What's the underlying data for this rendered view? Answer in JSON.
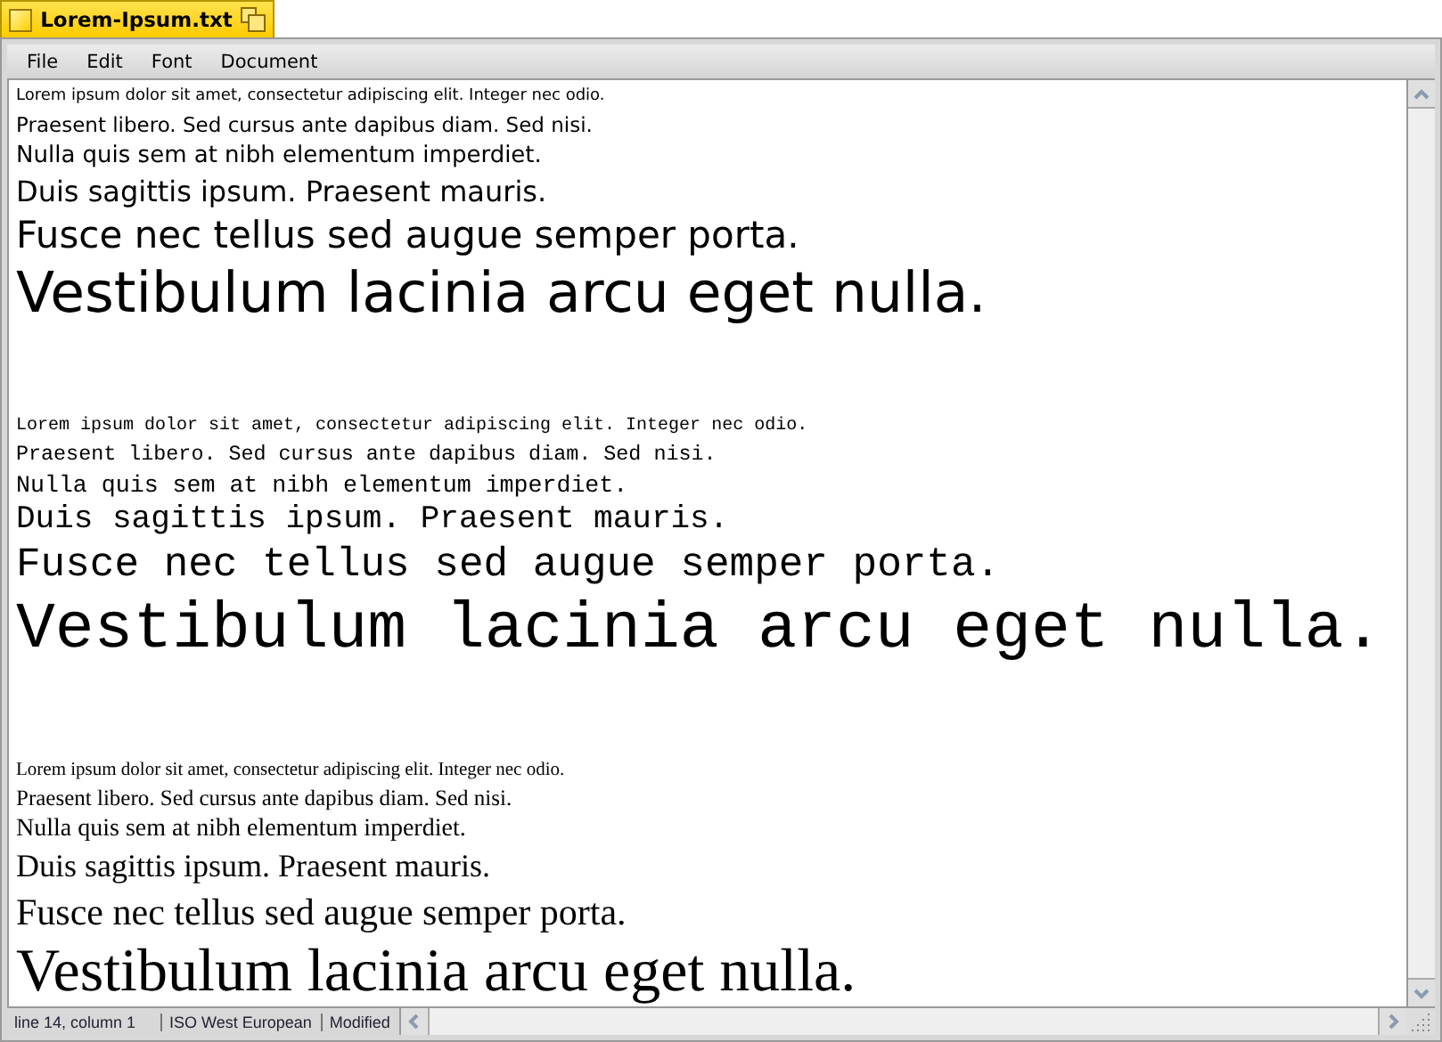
{
  "window": {
    "title": "Lorem-Ipsum.txt"
  },
  "menu": [
    "File",
    "Edit",
    "Font",
    "Document"
  ],
  "blocks": [
    {
      "kind": "sans",
      "lines": [
        "Lorem ipsum dolor sit amet, consectetur adipiscing elit. Integer nec odio.",
        "Praesent libero. Sed cursus ante dapibus diam. Sed nisi.",
        "Nulla quis sem at nibh elementum imperdiet.",
        "Duis sagittis ipsum. Praesent mauris.",
        "Fusce nec tellus sed augue semper porta.",
        "Vestibulum lacinia arcu eget nulla."
      ]
    },
    {
      "kind": "mono",
      "lines": [
        "Lorem ipsum dolor sit amet, consectetur adipiscing elit. Integer nec odio.",
        "Praesent libero. Sed cursus ante dapibus diam. Sed nisi.",
        "Nulla quis sem at nibh elementum imperdiet.",
        "Duis sagittis ipsum. Praesent mauris.",
        "Fusce nec tellus sed augue semper porta.",
        "Vestibulum lacinia arcu eget nulla."
      ]
    },
    {
      "kind": "serif",
      "lines": [
        "Lorem ipsum dolor sit amet, consectetur adipiscing elit. Integer nec odio.",
        "Praesent libero. Sed cursus ante dapibus diam. Sed nisi.",
        "Nulla quis sem at nibh elementum imperdiet.",
        "Duis sagittis ipsum. Praesent mauris.",
        "Fusce nec tellus sed augue semper porta.",
        "Vestibulum lacinia arcu eget nulla."
      ]
    }
  ],
  "status_bar": [
    "line 14, column 1",
    "ISO West European",
    "Modified"
  ]
}
